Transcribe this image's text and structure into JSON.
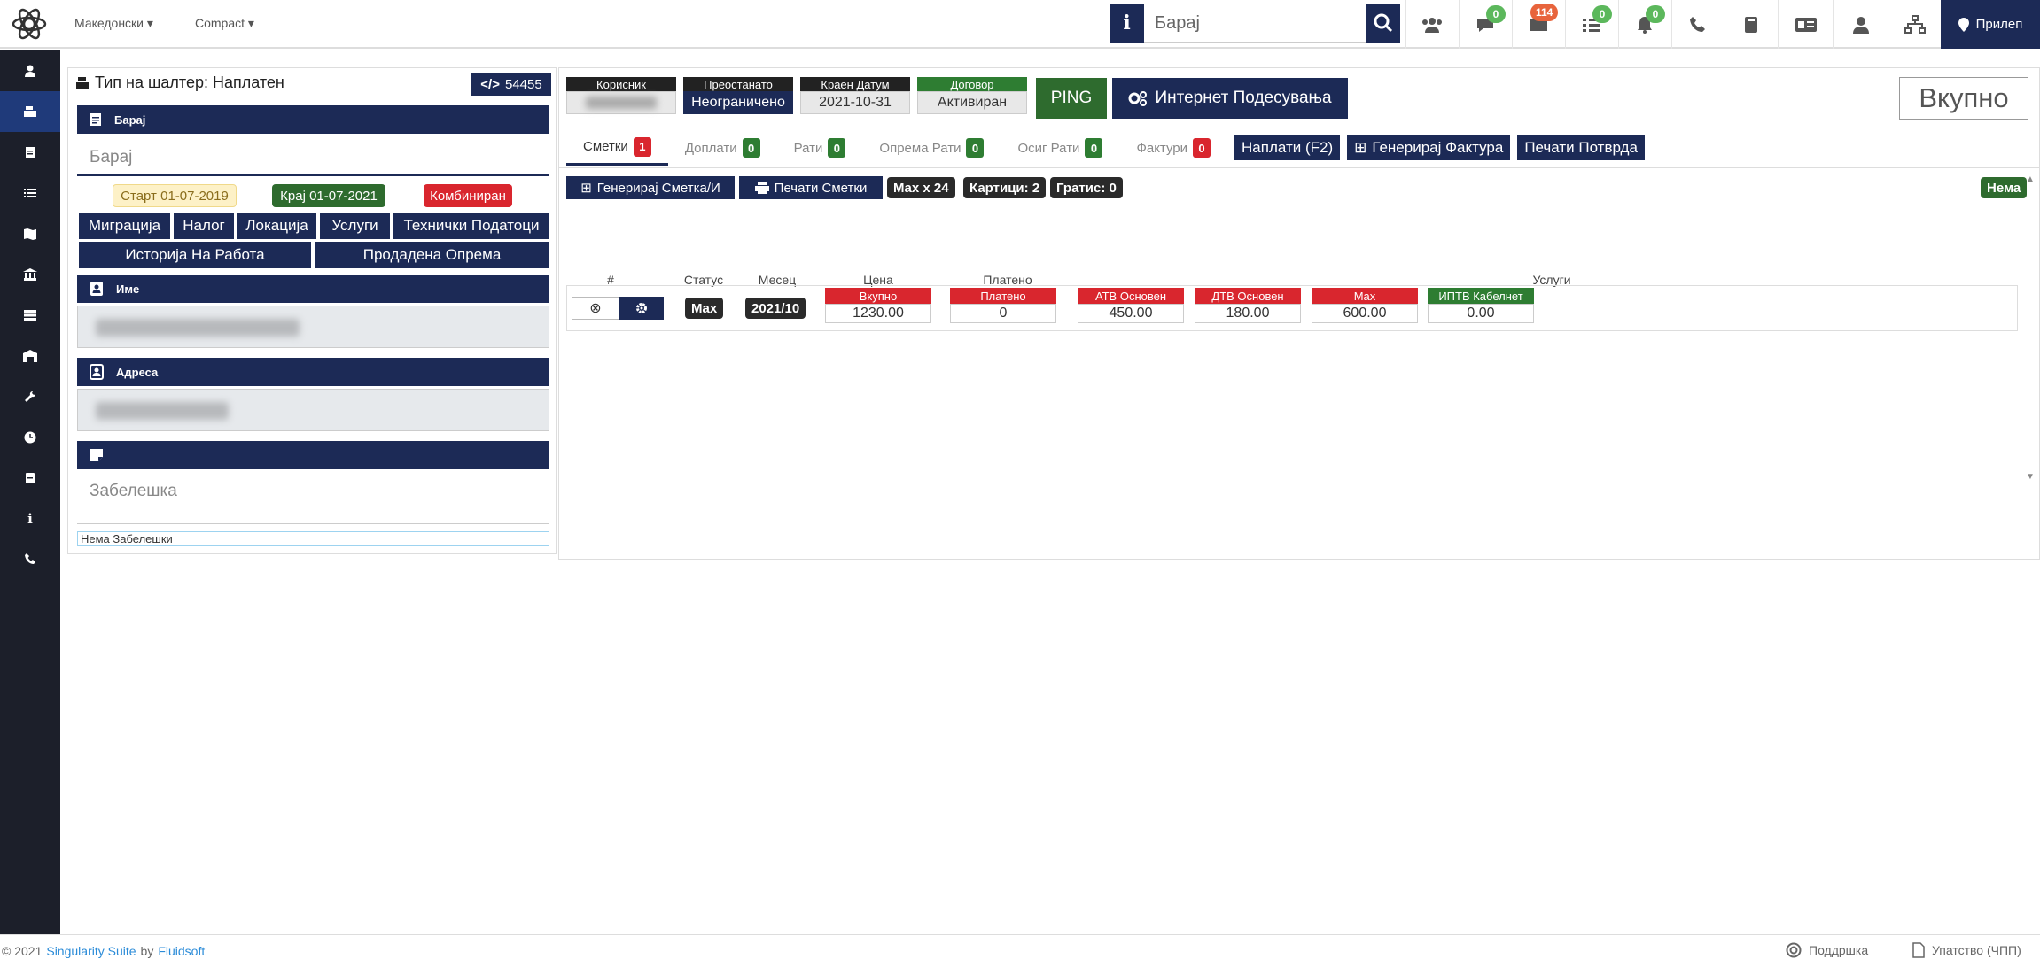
{
  "topbar": {
    "language": "Македонски",
    "theme": "Compact",
    "search_placeholder": "Барај",
    "badges": {
      "messages": "0",
      "inbox": "114",
      "tasks": "0",
      "alerts": "0"
    },
    "location": "Прилеп"
  },
  "left_panel": {
    "title": "Тип на шалтер: Наплатен",
    "code": "54455",
    "search_header": "Барај",
    "search_placeholder": "Барај",
    "tags": {
      "start": "Старт 01-07-2019",
      "end": "Крај 01-07-2021",
      "type": "Комбиниран"
    },
    "buttons": [
      "Миграција",
      "Налог",
      "Локација",
      "Услуги",
      "Технички Податоци"
    ],
    "buttons2": [
      "Историја На Работа",
      "Продадена Опрема"
    ],
    "name_header": "Име",
    "address_header": "Адреса",
    "note_placeholder": "Забелешка",
    "note_footer": "Нема Забелешки"
  },
  "right_panel": {
    "stats": [
      {
        "label": "Корисник",
        "value": ""
      },
      {
        "label": "Преостанато",
        "value": "Неограничено"
      },
      {
        "label": "Краен Датум",
        "value": "2021-10-31"
      },
      {
        "label": "Договор",
        "value": "Активиран"
      }
    ],
    "ping": "PING",
    "internet_settings": "Интернет Подесувања",
    "total": "Вкупно",
    "tabs": [
      {
        "label": "Сметки",
        "count": "1"
      },
      {
        "label": "Доплати",
        "count": "0"
      },
      {
        "label": "Рати",
        "count": "0"
      },
      {
        "label": "Опрема Рати",
        "count": "0"
      },
      {
        "label": "Осиг Рати",
        "count": "0"
      },
      {
        "label": "Фактури",
        "count": "0"
      }
    ],
    "tab_buttons": {
      "pay": "Наплати (F2)",
      "invoice": "Генерирај Фактура",
      "print": "Печати Потврда"
    },
    "tools": {
      "generate": "Генерирај Сметка/И",
      "print_bills": "Печати Сметки",
      "max": "Max x 24",
      "cards": "Картици: 2",
      "gratis": "Гратис: 0",
      "none": "Нема"
    },
    "columns": [
      "#",
      "Статус",
      "Месец",
      "Цена",
      "Платено",
      "Услуги"
    ],
    "row": {
      "status": "Max",
      "month": "2021/10",
      "price_label": "Вкупно",
      "price": "1230.00",
      "paid_label": "Платено",
      "paid": "0",
      "services": [
        {
          "label": "АТВ Основен",
          "value": "450.00"
        },
        {
          "label": "ДТВ Основен",
          "value": "180.00"
        },
        {
          "label": "Max",
          "value": "600.00"
        },
        {
          "label": "ИПТВ Кабелнет",
          "value": "0.00"
        }
      ]
    }
  },
  "footer": {
    "copyright": "© 2021",
    "product": "Singularity Suite",
    "by": "by",
    "company": "Fluidsoft",
    "support": "Поддршка",
    "manual": "Упатство (ЧПП)"
  },
  "colors": {
    "navy": "#1c2a56",
    "sidebar": "#1c1f2a",
    "red": "#d9262e",
    "green": "#2e7d32"
  }
}
